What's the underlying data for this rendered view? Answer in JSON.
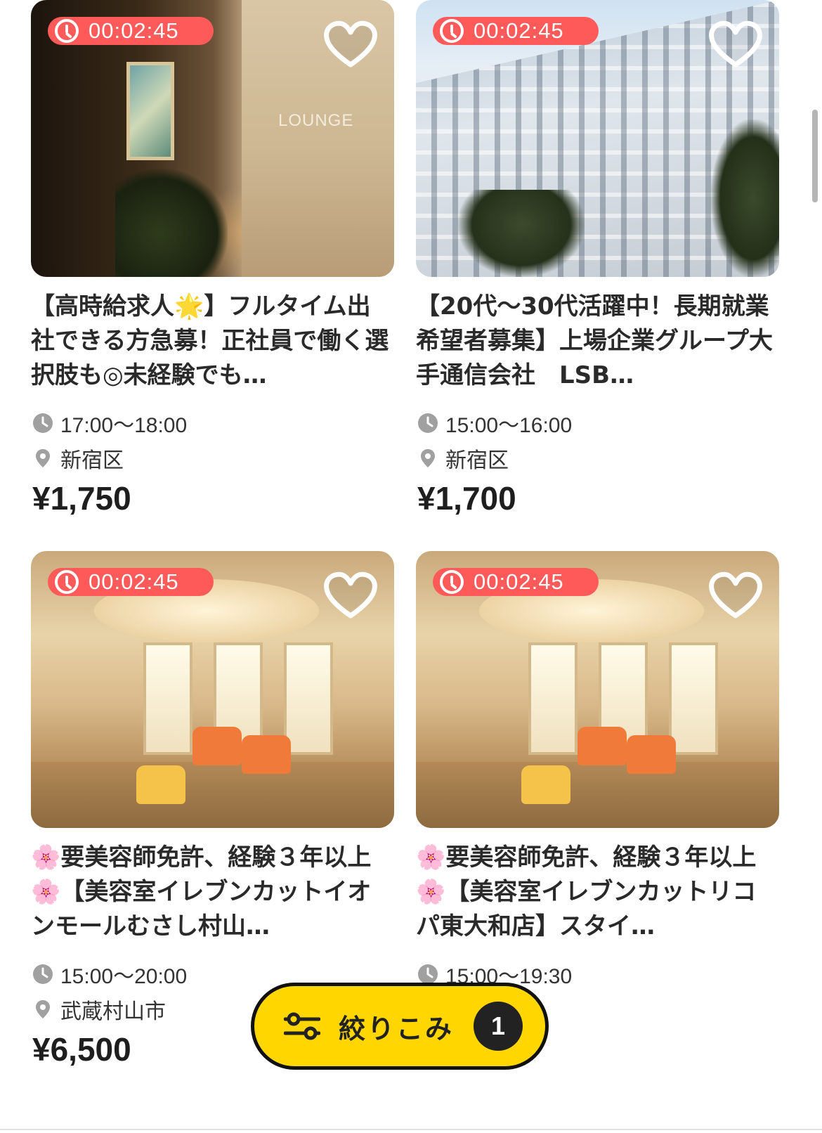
{
  "jobs": [
    {
      "timer": "00:02:45",
      "title": "【高時給求人🌟】フルタイム出社できる方急募！正社員で働く選択肢も◎未経験でも…",
      "time": "17:00〜18:00",
      "location": "新宿区",
      "price": "¥1,750",
      "image_sign": "LOUNGE"
    },
    {
      "timer": "00:02:45",
      "title": "【20代〜30代活躍中！長期就業希望者募集】上場企業グループ大手通信会社　LSB…",
      "time": "15:00〜16:00",
      "location": "新宿区",
      "price": "¥1,700"
    },
    {
      "timer": "00:02:45",
      "title": "🌸要美容師免許、経験３年以上🌸【美容室イレブンカットイオンモールむさし村山…",
      "time": "15:00〜20:00",
      "location": "武蔵村山市",
      "price": "¥6,500"
    },
    {
      "timer": "00:02:45",
      "title": "🌸要美容師免許、経験３年以上🌸【美容室イレブンカットリコパ東大和店】スタイ…",
      "time": "15:00〜19:30"
    }
  ],
  "filter_button": {
    "label": "絞りこみ",
    "count": "1"
  },
  "colors": {
    "timer_bg": "#ff5a5a",
    "filter_bg": "#ffd600",
    "text": "#222222"
  }
}
